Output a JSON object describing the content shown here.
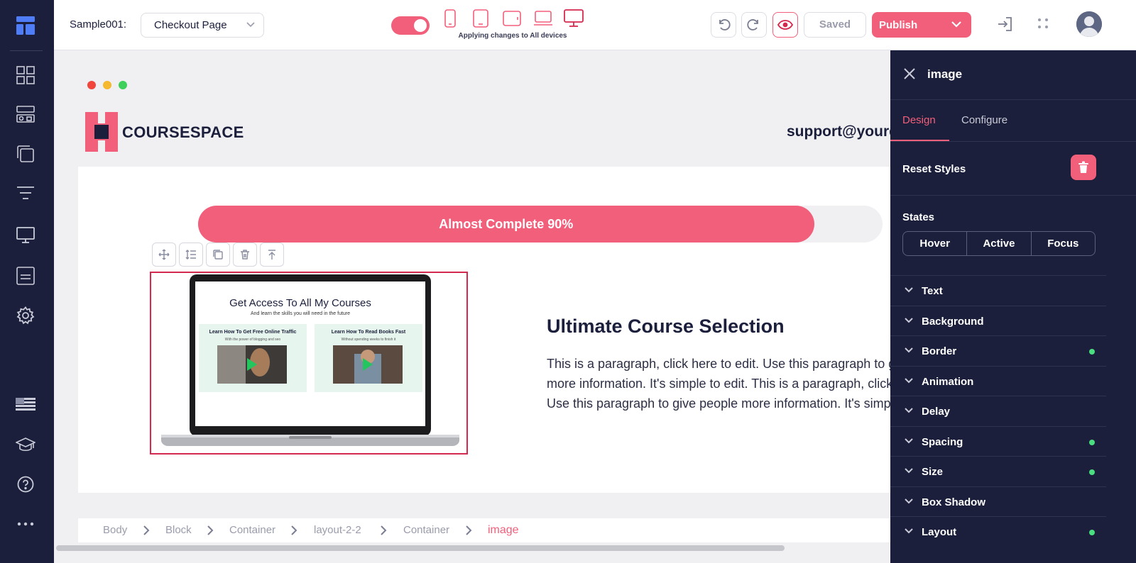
{
  "topbar": {
    "project_label": "Sample001:",
    "page_select_value": "Checkout Page",
    "applying_text": "Applying changes to All devices",
    "saved_label": "Saved",
    "publish_label": "Publish"
  },
  "leftbar": {
    "icons": [
      "logo-icon",
      "blocks-icon",
      "sections-icon",
      "pages-icon",
      "filter-icon",
      "desktop-icon",
      "form-icon",
      "settings-icon",
      "language-flag-icon",
      "courses-icon",
      "help-icon",
      "more-icon"
    ]
  },
  "canvas": {
    "logo_text": "COURSESPACE",
    "support_text": "support@yourdomain.com",
    "progress": {
      "label": "Almost Complete 90%",
      "value": 0.9
    },
    "laptop": {
      "title": "Get Access To All My Courses",
      "subtitle": "And learn the skills you will need in the future",
      "cards": [
        {
          "title": "Learn How To Get Free Online Traffic",
          "subtitle": "With the power of blogging and seo"
        },
        {
          "title": "Learn How To Read Books Fast",
          "subtitle": "Without spending weeks to finish it"
        }
      ]
    },
    "heading": "Ultimate Course Selection",
    "paragraph_lines": [
      "This is a paragraph, click here to edit. Use this paragraph to give people",
      "more information. It's simple to edit. This is a paragraph, click here to edit.",
      "Use this paragraph to give people more information. It's simple to edit."
    ]
  },
  "breadcrumb": [
    "Body",
    "Block",
    "Container",
    "layout-2-2",
    "Container",
    "image"
  ],
  "panel": {
    "title": "image",
    "tabs": [
      "Design",
      "Configure"
    ],
    "reset_label": "Reset Styles",
    "states_label": "States",
    "states": [
      "Hover",
      "Active",
      "Focus"
    ],
    "sections": [
      {
        "label": "Text",
        "modified": false
      },
      {
        "label": "Background",
        "modified": false
      },
      {
        "label": "Border",
        "modified": true
      },
      {
        "label": "Animation",
        "modified": false
      },
      {
        "label": "Delay",
        "modified": false
      },
      {
        "label": "Spacing",
        "modified": true
      },
      {
        "label": "Size",
        "modified": true
      },
      {
        "label": "Box Shadow",
        "modified": false
      },
      {
        "label": "Layout",
        "modified": true
      }
    ]
  },
  "colors": {
    "accent": "#f25f7b",
    "navy": "#1b1f3b",
    "selection": "#d6294f",
    "modified_dot": "#4ade80"
  }
}
